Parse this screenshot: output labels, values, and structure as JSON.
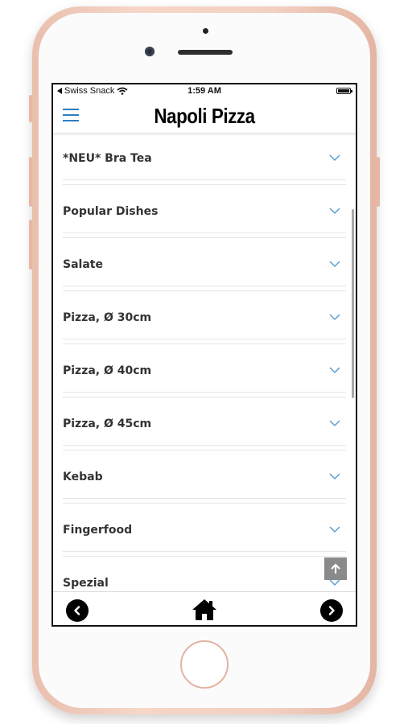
{
  "status_bar": {
    "back_app": "Swiss Snack",
    "time": "1:59 AM"
  },
  "header": {
    "title": "Napoli Pizza"
  },
  "menu_categories": [
    {
      "label": "*NEU* Bra Tea"
    },
    {
      "label": "Popular Dishes"
    },
    {
      "label": "Salate"
    },
    {
      "label": "Pizza, Ø 30cm"
    },
    {
      "label": "Pizza, Ø 40cm"
    },
    {
      "label": "Pizza, Ø 45cm"
    },
    {
      "label": "Kebab"
    },
    {
      "label": "Fingerfood"
    },
    {
      "label": "Spezial"
    }
  ],
  "colors": {
    "accent": "#2d7fc1",
    "phone_frame": "#f3d0c1",
    "chevron": "#5a9fd4"
  },
  "icons": {
    "menu": "hamburger-icon",
    "expand": "chevron-down-icon",
    "scroll_top": "arrow-up-icon",
    "prev": "chevron-left-icon",
    "home": "home-icon",
    "next": "chevron-right-icon"
  }
}
